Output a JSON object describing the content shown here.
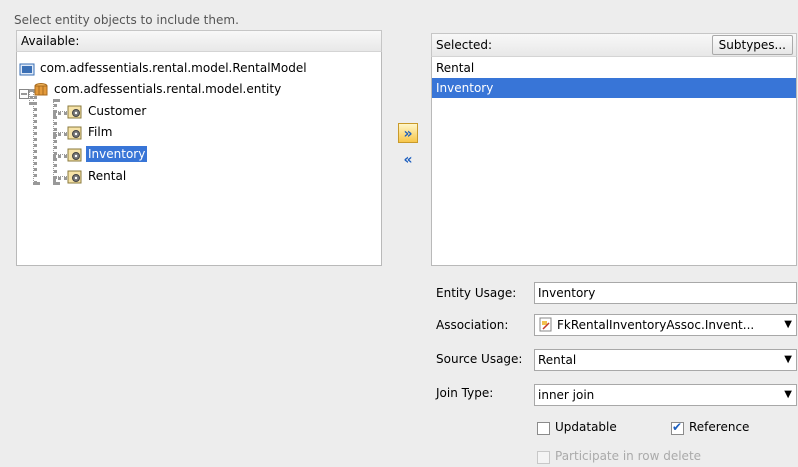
{
  "instruction": "Select entity objects to include them.",
  "available": {
    "header": "Available:",
    "tree": {
      "root_model": "com.adfessentials.rental.model.RentalModel",
      "package": "com.adfessentials.rental.model.entity",
      "entities": [
        "Customer",
        "Film",
        "Inventory",
        "Rental"
      ],
      "highlighted": "Inventory"
    }
  },
  "selected": {
    "header": "Selected:",
    "subtypes_button": "Subtypes...",
    "items": [
      "Rental",
      "Inventory"
    ],
    "selected_item": "Inventory"
  },
  "shuttle": {
    "add_icon": "double-chevron-right-icon",
    "remove_icon": "double-chevron-left-icon"
  },
  "form": {
    "entity_usage_label": "Entity Usage:",
    "entity_usage_value": "Inventory",
    "association_label": "Association:",
    "association_value": "FkRentalInventoryAssoc.Invent...",
    "source_usage_label": "Source Usage:",
    "source_usage_value": "Rental",
    "join_type_label": "Join Type:",
    "join_type_value": "inner join",
    "updatable_label": "Updatable",
    "updatable_checked": false,
    "reference_label": "Reference",
    "reference_checked": true,
    "participate_label": "Participate in row delete",
    "participate_checked": false,
    "participate_enabled": false
  },
  "colors": {
    "selection": "#3875d7",
    "background": "#ededed",
    "shuttle_accent": "#f7c64a"
  }
}
